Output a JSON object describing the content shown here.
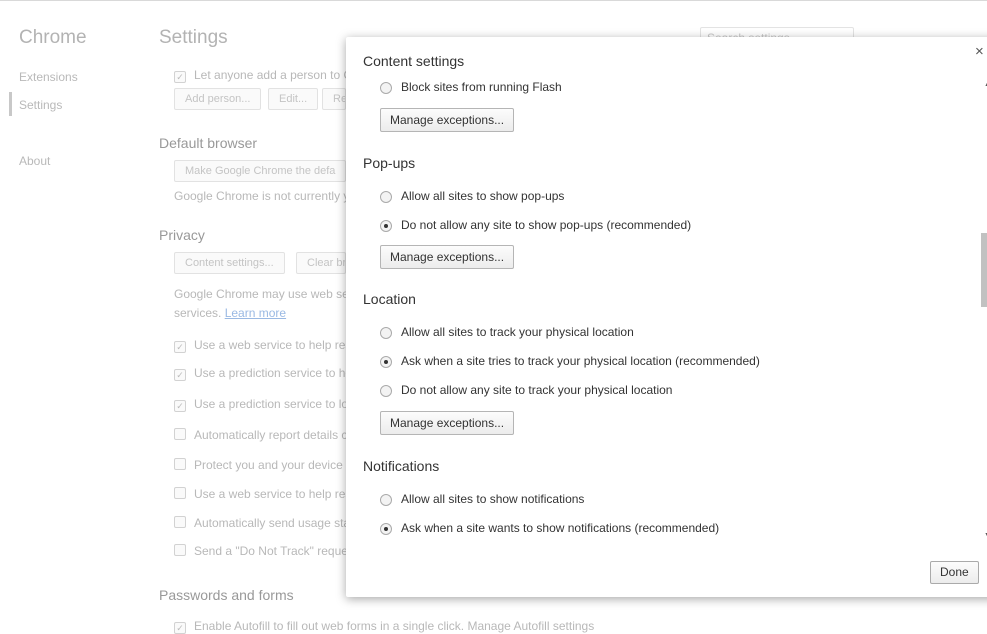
{
  "sidebar": {
    "title": "Chrome",
    "items": [
      {
        "label": "Extensions"
      },
      {
        "label": "Settings"
      },
      {
        "label": "About"
      }
    ]
  },
  "page": {
    "title": "Settings",
    "search_placeholder": "Search settings",
    "people": {
      "let_anyone_label": "Let anyone add a person to C",
      "add_person_button": "Add person...",
      "edit_button": "Edit...",
      "remove_button": "Re"
    },
    "default_browser": {
      "heading": "Default browser",
      "make_default_button": "Make Google Chrome the defa",
      "status_text": "Google Chrome is not currently y"
    },
    "privacy": {
      "heading": "Privacy",
      "content_settings_button": "Content settings...",
      "clear_button": "Clear br",
      "desc_line1": "Google Chrome may use web ser",
      "desc_line2": "services.",
      "learn_more": "Learn more",
      "options": [
        {
          "label": "Use a web service to help res",
          "checked": true
        },
        {
          "label": "Use a prediction service to he",
          "checked": true
        },
        {
          "label": "Use a prediction service to lo",
          "checked": true
        },
        {
          "label": "Automatically report details c",
          "checked": false
        },
        {
          "label": "Protect you and your device f",
          "checked": false
        },
        {
          "label": "Use a web service to help res",
          "checked": false
        },
        {
          "label": "Automatically send usage sta",
          "checked": false
        },
        {
          "label": "Send a \"Do Not Track\" reque",
          "checked": false
        }
      ]
    },
    "passwords": {
      "heading": "Passwords and forms",
      "autofill_text": "Enable Autofill to fill out web forms in a single click. Manage Autofill settings"
    }
  },
  "dialog": {
    "title": "Content settings",
    "close_label": "×",
    "flash_option": {
      "label": "Block sites from running Flash",
      "selected": false
    },
    "flash_manage_button": "Manage exceptions...",
    "popups": {
      "heading": "Pop-ups",
      "options": [
        {
          "label": "Allow all sites to show pop-ups",
          "selected": false
        },
        {
          "label": "Do not allow any site to show pop-ups (recommended)",
          "selected": true
        }
      ],
      "manage_button": "Manage exceptions..."
    },
    "location": {
      "heading": "Location",
      "options": [
        {
          "label": "Allow all sites to track your physical location",
          "selected": false
        },
        {
          "label": "Ask when a site tries to track your physical location (recommended)",
          "selected": true
        },
        {
          "label": "Do not allow any site to track your physical location",
          "selected": false
        }
      ],
      "manage_button": "Manage exceptions..."
    },
    "notifications": {
      "heading": "Notifications",
      "options": [
        {
          "label": "Allow all sites to show notifications",
          "selected": false
        },
        {
          "label": "Ask when a site wants to show notifications (recommended)",
          "selected": true
        }
      ]
    },
    "done_button": "Done"
  }
}
